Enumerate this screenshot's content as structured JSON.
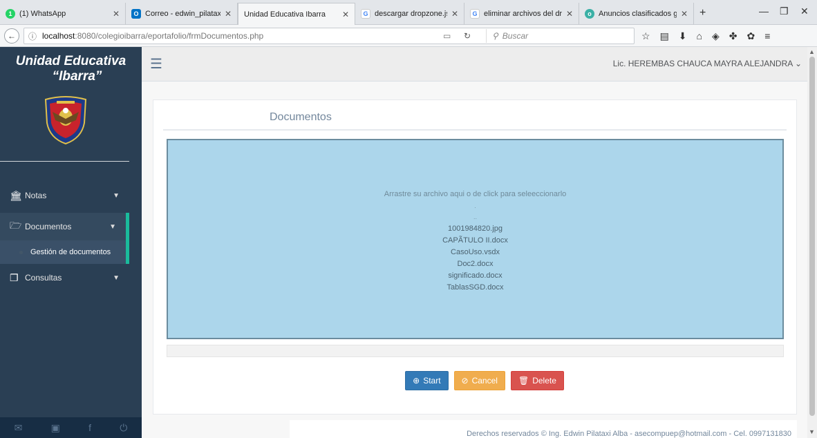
{
  "browser": {
    "tabs": [
      {
        "title": "(1) WhatsApp",
        "icon": "whatsapp-icon",
        "color": "#25d366"
      },
      {
        "title": "Correo - edwin_pilataxi@",
        "icon": "outlook-icon",
        "color": "#0072c6"
      },
      {
        "title": "Unidad Educativa Ibarra",
        "icon": "",
        "color": ""
      },
      {
        "title": "descargar dropzone.js - ",
        "icon": "google-icon",
        "color": "#4285f4"
      },
      {
        "title": "eliminar archivos del dro",
        "icon": "google-icon",
        "color": "#4285f4"
      },
      {
        "title": "Anuncios clasificados gr",
        "icon": "olx-icon",
        "color": "#3ab0a6"
      }
    ],
    "url_host": "localhost",
    "url_path": ":8080/colegioibarra/eportafolio/frmDocumentos.php",
    "search_placeholder": "Buscar"
  },
  "sidebar": {
    "brand_line1": "Unidad Educativa",
    "brand_line2": "“Ibarra”",
    "menu": [
      {
        "label": "Notas",
        "icon": "institution-icon"
      },
      {
        "label": "Documentos",
        "icon": "folder-open-icon"
      },
      {
        "label": "Consultas",
        "icon": "clone-icon"
      }
    ],
    "submenu_label": "Gestión de documentos",
    "footer_icons": [
      "envelope-icon",
      "twitter-icon",
      "facebook-icon",
      "power-icon"
    ]
  },
  "topnav": {
    "user_name": "Lic. HEREMBAS CHAUCA MAYRA ALEJANDRA"
  },
  "panel": {
    "title": "Documentos",
    "dropzone_message": "Arrastre su archivo aqui o de click para seleeccionarlo",
    "dropzone_dot1": ".",
    "dropzone_dot2": "..",
    "files": [
      "1001984820.jpg",
      "CAPÃTULO II.docx",
      "CasoUso.vsdx",
      "Doc2.docx",
      "significado.docx",
      "TablasSGD.docx"
    ],
    "buttons": {
      "start": "Start",
      "cancel": "Cancel",
      "delete": "Delete"
    }
  },
  "footer": {
    "text": "Derechos reservados © Ing. Edwin Pilataxi Alba - asecompuep@hotmail.com - Cel. 0997131830"
  },
  "colors": {
    "sidebar": "#2a3f54",
    "accent": "#1abb9c",
    "dropzone": "#acd6eb"
  }
}
